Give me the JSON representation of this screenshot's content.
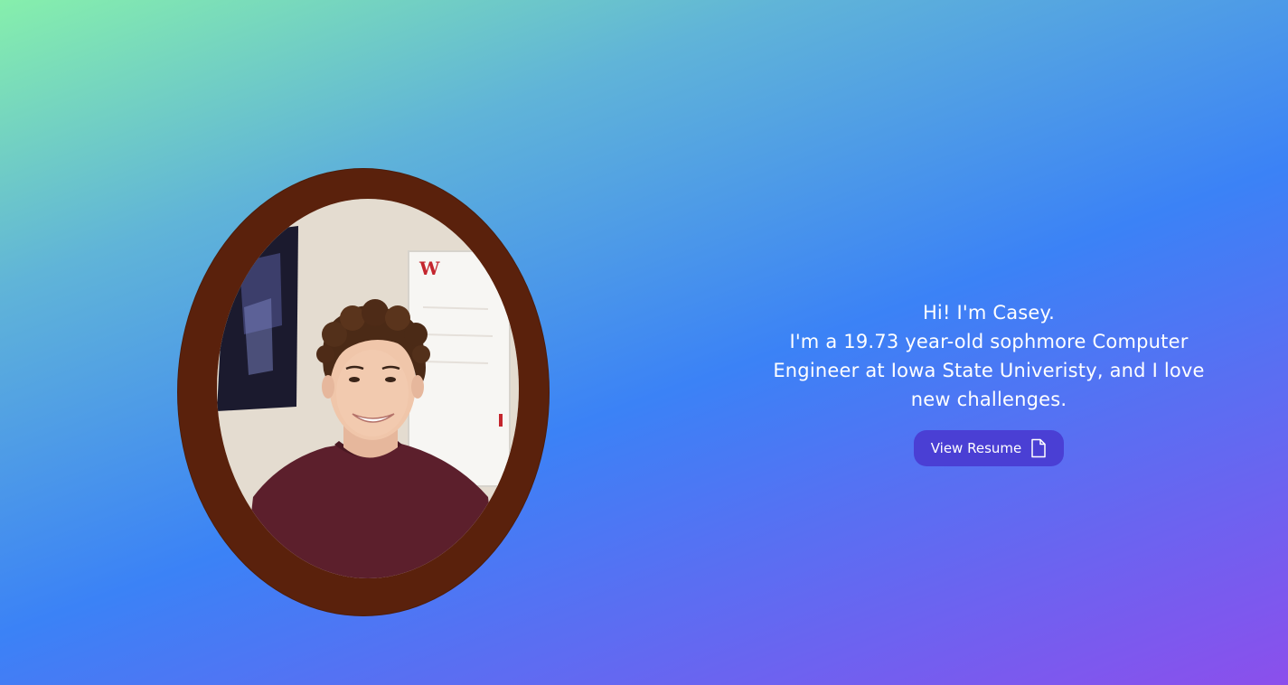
{
  "hero": {
    "greeting": "Hi! I'm Casey.",
    "bio": "I'm a 19.73 year-old sophmore Computer Engineer at Iowa State Univeristy, and I love new challenges.",
    "resume_button_label": "View Resume",
    "resume_icon": "document-icon"
  },
  "colors": {
    "gradient_start": "#86efac",
    "gradient_mid": "#3b82f6",
    "gradient_end": "#8b4fec",
    "frame": "#5a210c",
    "button": "#4a3fd4"
  }
}
